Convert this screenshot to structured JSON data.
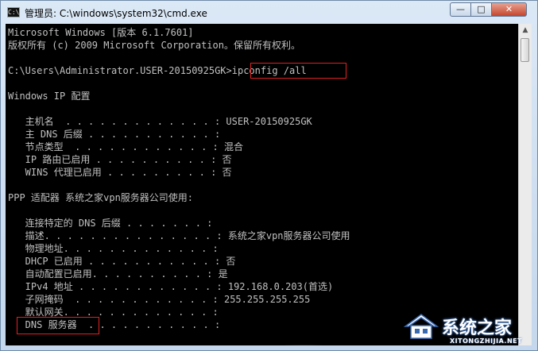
{
  "window": {
    "title": "管理员: C:\\windows\\system32\\cmd.exe",
    "icon_text": "C:\\",
    "controls": {
      "minimize": "—",
      "maximize": "□",
      "close": "✕"
    }
  },
  "console": {
    "lines": [
      "Microsoft Windows [版本 6.1.7601]",
      "版权所有 (c) 2009 Microsoft Corporation。保留所有权利。",
      "C:\\Users\\Administrator.USER-20150925GK>ipconfig /all",
      "Windows IP 配置",
      "   主机名  . . . . . . . . . . . . . : USER-20150925GK",
      "   主 DNS 后缀 . . . . . . . . . . . :",
      "   节点类型  . . . . . . . . . . . . : 混合",
      "   IP 路由已启用 . . . . . . . . . . : 否",
      "   WINS 代理已启用 . . . . . . . . . : 否",
      "PPP 适配器 系统之家vpn服务器公司使用:",
      "   连接特定的 DNS 后缀 . . . . . . . :",
      "   描述. . . . . . . . . . . . . . . : 系统之家vpn服务器公司使用",
      "   物理地址. . . . . . . . . . . . . :",
      "   DHCP 已启用 . . . . . . . . . . . : 否",
      "   自动配置已启用. . . . . . . . . . : 是",
      "   IPv4 地址 . . . . . . . . . . . . : 192.168.0.203(首选)",
      "   子网掩码  . . . . . . . . . . . . : 255.255.255.255",
      "   默认网关. . . . . . . . . . . . . :",
      "   DNS 服务器  . . . . . . . . . . . :"
    ]
  },
  "highlights": {
    "command": "ipconfig /all",
    "dns_label": "DNS 服务器"
  },
  "watermark": {
    "name": "系统之家",
    "url": "XITONGZHIJIA.NET"
  },
  "colors": {
    "console_bg": "#000000",
    "console_text": "#c0c0c0",
    "highlight": "#e02020",
    "close_button": "#c4452c"
  }
}
